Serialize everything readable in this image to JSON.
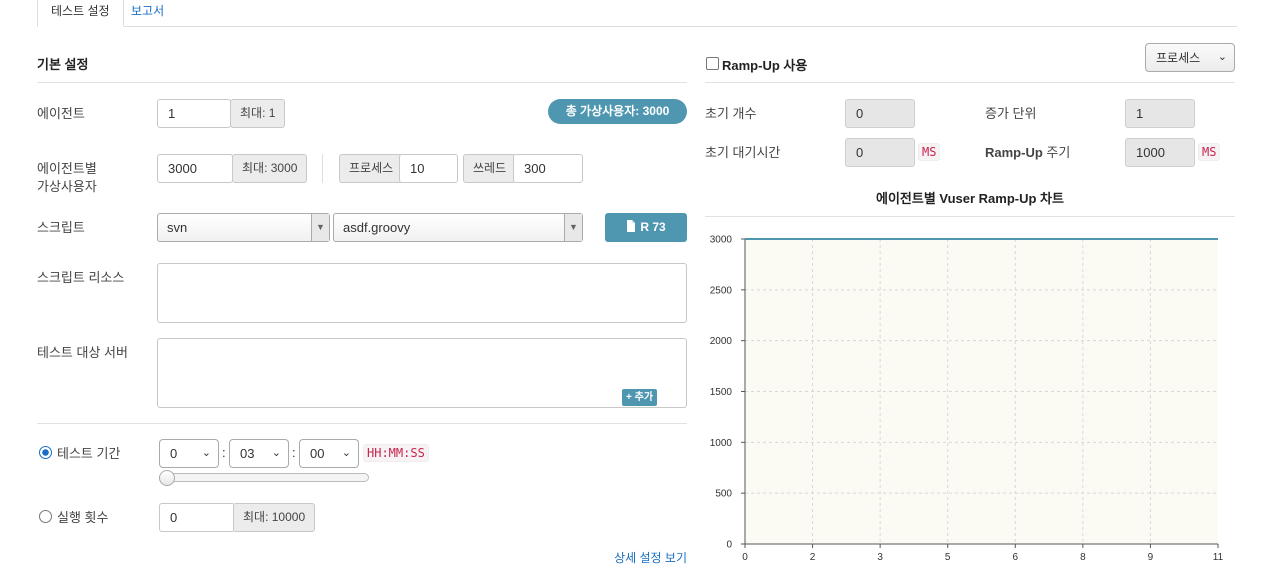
{
  "tabs": [
    {
      "label": "테스트 설정"
    },
    {
      "label": "보고서"
    }
  ],
  "basic": {
    "title": "기본 설정",
    "agent": {
      "label": "에이전트",
      "value": "1",
      "max": "최대: 1"
    },
    "total_vuser_badge": "총 가상사용자: 3000",
    "vuser": {
      "label_line1": "에이전트별",
      "label_line2": "가상사용자",
      "value": "3000",
      "max": "최대: 3000",
      "process_label": "프로세스",
      "process_value": "10",
      "thread_label": "쓰레드",
      "thread_value": "300"
    },
    "script": {
      "label": "스크립트",
      "repo": "svn",
      "file": "asdf.groovy",
      "revision_button": "R 73"
    },
    "script_resources": {
      "label": "스크립트 리소스"
    },
    "target_server": {
      "label": "테스트 대상 서버",
      "add_button": "추가"
    },
    "duration": {
      "label": "테스트 기간",
      "hours": "0",
      "minutes": "03",
      "seconds": "00",
      "format": "HH:MM:SS",
      "slider_level": 0
    },
    "run_count": {
      "label": "실행 횟수",
      "value": "0",
      "max": "최대: 10000"
    },
    "detail_link": "상세 설정 보기"
  },
  "rampup": {
    "title": "Ramp-Up 사용",
    "enabled": false,
    "type_select": "프로세스",
    "initial_count": {
      "label": "초기 개수",
      "value": "0"
    },
    "increment": {
      "label": "증가 단위",
      "value": "1"
    },
    "initial_sleep": {
      "label": "초기 대기시간",
      "value": "0",
      "unit": "MS"
    },
    "interval": {
      "label_bold": "Ramp-Up",
      "label_rest": " 주기",
      "value": "1000",
      "unit": "MS"
    }
  },
  "chart_data": {
    "type": "line",
    "title": "에이전트별 Vuser Ramp-Up 차트",
    "x": [
      0,
      11
    ],
    "values": [
      3000,
      3000
    ],
    "x_ticks": [
      "0",
      "2",
      "3",
      "5",
      "6",
      "8",
      "9",
      "11"
    ],
    "y_ticks": [
      "0",
      "500",
      "1000",
      "1500",
      "2000",
      "2500",
      "3000"
    ],
    "xlim": [
      0,
      11
    ],
    "ylim": [
      0,
      3000
    ],
    "grid": true,
    "colors": {
      "line": "#4f97b1",
      "plot_bg": "#fbfbf3",
      "grid": "#d8d8d8"
    }
  }
}
